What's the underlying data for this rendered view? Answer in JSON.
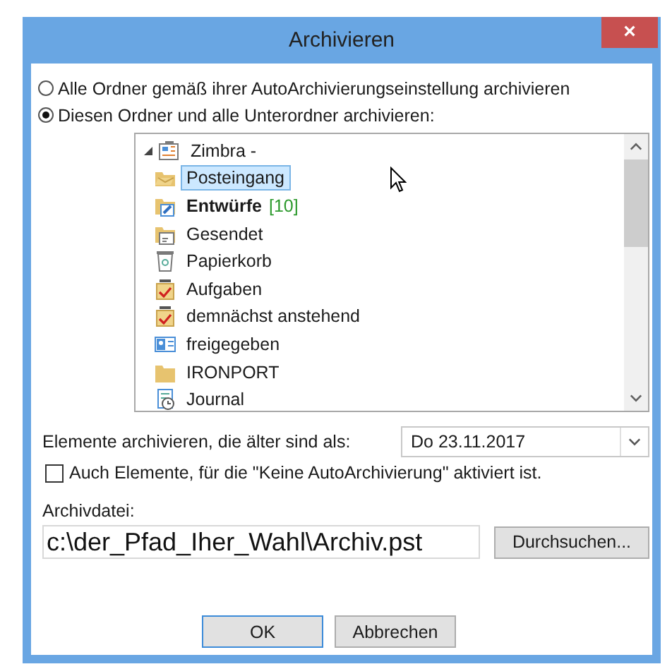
{
  "window": {
    "title": "Archivieren",
    "close_label": "×"
  },
  "options": [
    {
      "label": "Alle Ordner gemäß ihrer AutoArchivierungseinstellung archivieren",
      "selected": false
    },
    {
      "label": "Diesen Ordner und alle Unterordner archivieren:",
      "selected": true
    }
  ],
  "folder_tree": [
    {
      "label": "Zimbra -",
      "kind": "mailbox",
      "expanded": true,
      "selected": false,
      "children": [
        {
          "label": "Posteingang",
          "kind": "inbox",
          "selected": true
        },
        {
          "label": "Entwürfe",
          "kind": "drafts",
          "selected": false,
          "count": "[10]"
        },
        {
          "label": "Gesendet",
          "kind": "sent",
          "selected": false
        },
        {
          "label": "Papierkorb",
          "kind": "trash",
          "selected": false
        },
        {
          "label": "Aufgaben",
          "kind": "tasks",
          "selected": false
        },
        {
          "label": "demnächst anstehend",
          "kind": "tasks",
          "selected": false
        },
        {
          "label": "freigegeben",
          "kind": "contacts",
          "selected": false
        },
        {
          "label": "IRONPORT",
          "kind": "folder",
          "selected": false
        },
        {
          "label": "Journal",
          "kind": "journal",
          "selected": false
        }
      ]
    }
  ],
  "older_than": {
    "label": "Elemente archivieren, die älter sind als:",
    "value": "Do 23.11.2017"
  },
  "include_no_autoarchive": {
    "label": "Auch Elemente, für die \"Keine AutoArchivierung\" aktiviert ist.",
    "checked": false
  },
  "archive_file": {
    "label": "Archivdatei:",
    "value": "c:\\der_Pfad_Iher_Wahl\\Archiv.pst",
    "browse_button": "Durchsuchen..."
  },
  "buttons": [
    "OK",
    "Abbrechen"
  ]
}
